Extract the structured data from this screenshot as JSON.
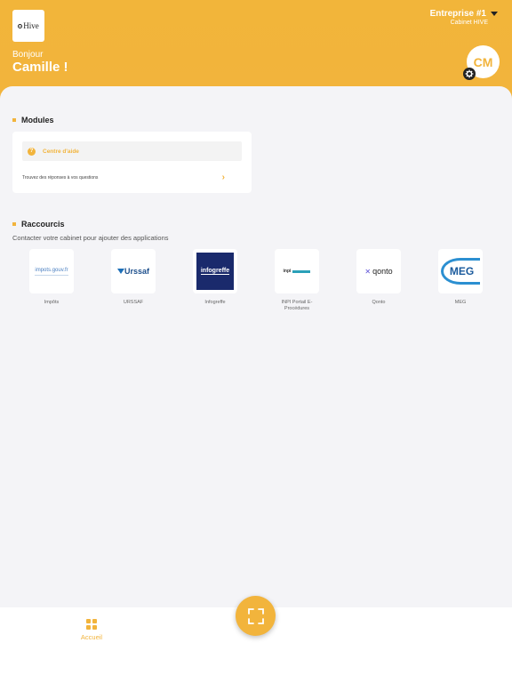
{
  "header": {
    "logo_text": "Hive",
    "greeting": "Bonjour",
    "user_name": "Camille !",
    "company_name": "Entreprise #1",
    "company_sub": "Cabinet HIVE",
    "avatar_initials": "CM",
    "brand_color": "#f2b43c"
  },
  "modules": {
    "title": "Modules",
    "items": [
      {
        "label": "Centre d'aide",
        "description": "Trouvez des réponses à vos questions",
        "icon": "help-circle-icon"
      }
    ]
  },
  "shortcuts": {
    "title": "Raccourcis",
    "subtitle": "Contacter votre cabinet pour ajouter des applications",
    "apps": [
      {
        "label": "Impôts",
        "logo_text": "impots.gouv.fr"
      },
      {
        "label": "URSSAF",
        "logo_text": "Urssaf"
      },
      {
        "label": "Infogreffe",
        "logo_text": "infogreffe"
      },
      {
        "label": "INPI Portail E-Procédures",
        "logo_text": "inpi"
      },
      {
        "label": "Qonto",
        "logo_text": "qonto"
      },
      {
        "label": "MEG",
        "logo_text": "MEG"
      }
    ]
  },
  "nav": {
    "home_label": "Accueil",
    "scan_icon": "scan-frame-icon"
  }
}
